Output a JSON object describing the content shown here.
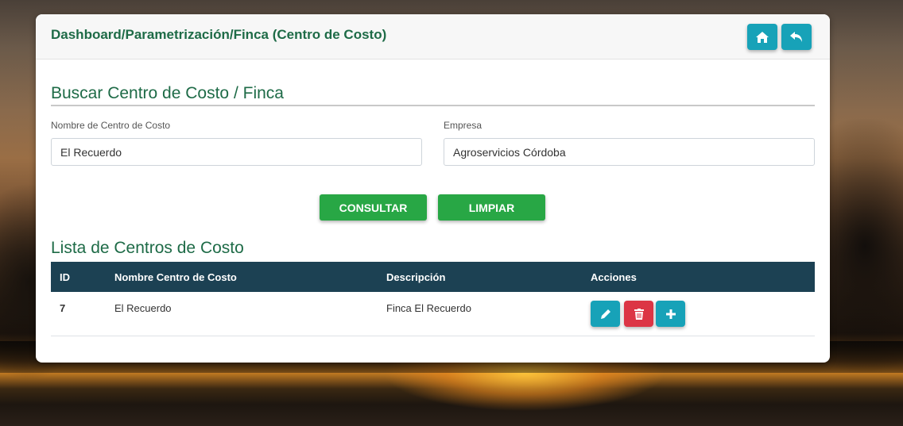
{
  "header": {
    "breadcrumb": "Dashboard/Parametrización/Finca (Centro de Costo)",
    "home_icon": "home-icon",
    "back_icon": "reply-icon"
  },
  "search": {
    "title": "Buscar Centro de Costo / Finca",
    "name_label": "Nombre de Centro de Costo",
    "name_value": "El Recuerdo",
    "company_label": "Empresa",
    "company_value": "Agroservicios Córdoba",
    "consultar_label": "CONSULTAR",
    "limpiar_label": "LIMPIAR"
  },
  "list": {
    "title": "Lista de Centros de Costo",
    "columns": [
      "ID",
      "Nombre Centro de Costo",
      "Descripción",
      "Acciones"
    ],
    "rows": [
      {
        "id": "7",
        "name": "El Recuerdo",
        "description": "Finca El Recuerdo"
      }
    ]
  },
  "colors": {
    "accent_green": "#1e6b47",
    "button_green": "#28a745",
    "info": "#17a2b8",
    "danger": "#dc3545",
    "table_header": "#1c4153"
  }
}
